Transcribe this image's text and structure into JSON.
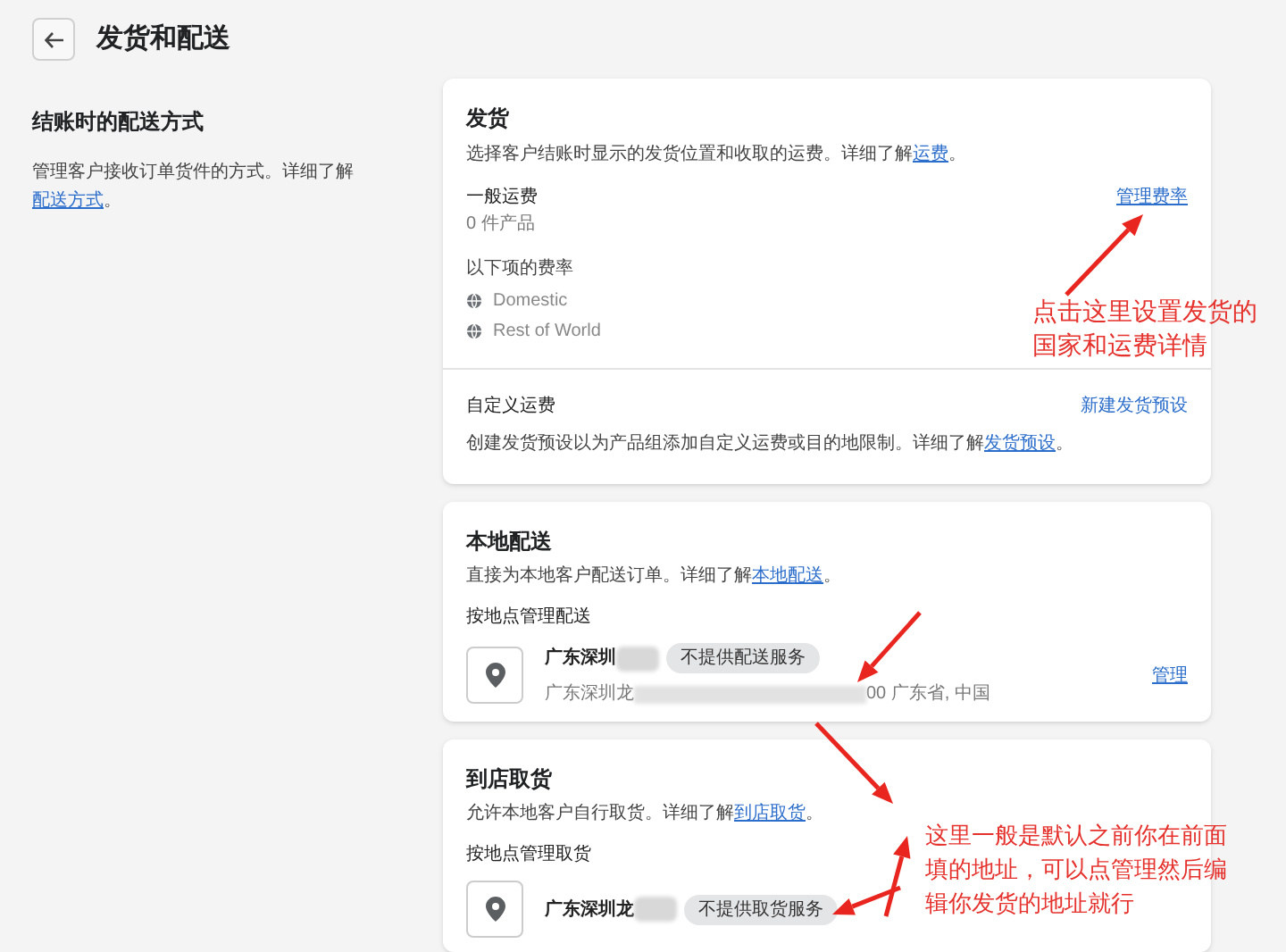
{
  "header": {
    "title": "发货和配送"
  },
  "sidebar": {
    "title": "结账时的配送方式",
    "description": {
      "text": "管理客户接收订单货件的方式。详细了解",
      "link": "配送方式",
      "end": "。"
    }
  },
  "shipping": {
    "title": "发货",
    "description": {
      "text": "选择客户结账时显示的发货位置和收取的运费。详细了解",
      "link": "运费",
      "end": "。"
    },
    "general": {
      "title": "一般运费",
      "subtitle": "0 件产品",
      "action": "管理费率",
      "rates_heading": "以下项的费率",
      "zones": [
        "Domestic",
        "Rest of World"
      ]
    },
    "custom": {
      "title": "自定义运费",
      "action": "新建发货预设",
      "description": {
        "text": "创建发货预设以为产品组添加自定义运费或目的地限制。详细了解",
        "link": "发货预设",
        "end": "。"
      }
    }
  },
  "local_delivery": {
    "title": "本地配送",
    "description": {
      "text": "直接为本地客户配送订单。详细了解",
      "link": "本地配送",
      "end": "。"
    },
    "section_label": "按地点管理配送",
    "location": {
      "name": "广东深圳",
      "badge": "不提供配送服务",
      "address_start": "广东深圳龙",
      "address_end": "00 广东省, 中国",
      "action": "管理"
    }
  },
  "pickup": {
    "title": "到店取货",
    "description": {
      "text": "允许本地客户自行取货。详细了解",
      "link": "到店取货",
      "end": "。"
    },
    "section_label": "按地点管理取货",
    "location": {
      "name": "广东深圳龙",
      "badge": "不提供取货服务"
    }
  },
  "annotations": [
    {
      "lines": [
        "点击这里设置发货的",
        "国家和运费详情"
      ]
    },
    {
      "lines": [
        "这里一般是默认之前你在前面",
        "填的地址，可以点管理然后编",
        "辑你发货的地址就行"
      ]
    }
  ]
}
